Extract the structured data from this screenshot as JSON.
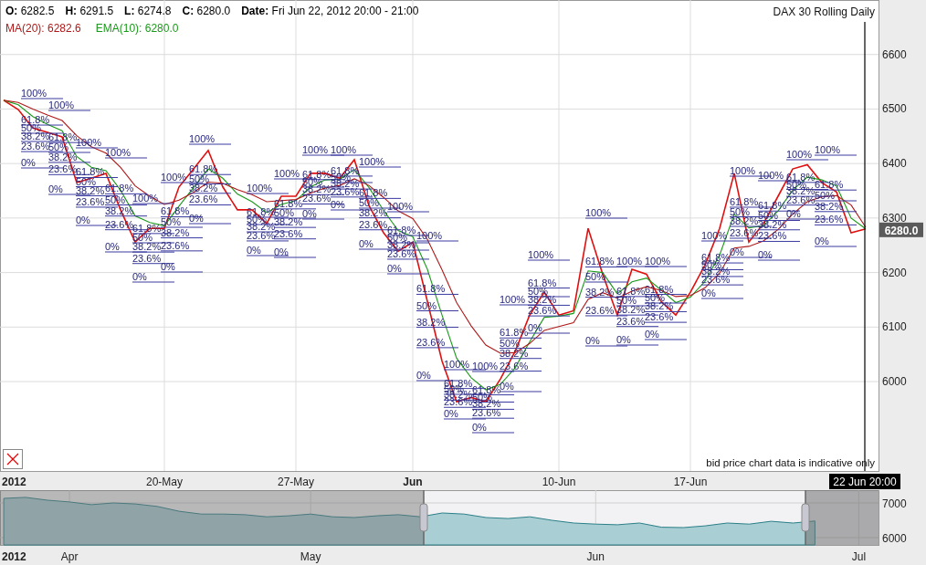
{
  "header": {
    "ohlc": [
      "**O:** 6282.5",
      "**H:** 6291.5",
      "**L:** 6274.8",
      "**C:** 6280.0",
      "**Date:** Fri Jun 22, 2012 20:00 - 21:00"
    ],
    "indicators": [
      {
        "text": "MA(20): 6282.6",
        "color": "#b01818"
      },
      {
        "text": "EMA(10): 6280.0",
        "color": "#1a9a1a"
      }
    ],
    "instrument": "DAX 30  Rolling Daily"
  },
  "main_chart": {
    "year_label": "2012",
    "price_tag": "6280.0",
    "cursor_date": "22 Jun 20:00",
    "disclaimer": "bid price chart data is indicative only",
    "chart_data": {
      "type": "line",
      "grid": true,
      "categories": [
        null,
        null,
        null,
        null,
        null,
        null,
        null,
        null,
        null,
        null,
        null,
        "20-May",
        null,
        null,
        null,
        null,
        null,
        null,
        null,
        null,
        "27-May",
        null,
        null,
        null,
        null,
        null,
        null,
        null,
        "Jun",
        null,
        null,
        null,
        null,
        null,
        null,
        null,
        null,
        null,
        "10-Jun",
        null,
        null,
        null,
        null,
        null,
        null,
        null,
        null,
        "17-Jun",
        null,
        null,
        null,
        null,
        null,
        null,
        null,
        null,
        null,
        null,
        null,
        null
      ],
      "ylim": [
        5836,
        6700
      ],
      "yticks": [
        6000,
        6100,
        6200,
        6300,
        6400,
        6500,
        6600
      ],
      "series": [
        {
          "color": "#e01010",
          "values": [
            6516,
            6499,
            6465,
            6457,
            6449,
            6365,
            6373,
            6382,
            6315,
            6256,
            6281,
            6281,
            6357,
            6390,
            6424,
            6357,
            6315,
            6315,
            6290,
            6340,
            6340,
            6382,
            6382,
            6373,
            6407,
            6323,
            6273,
            6239,
            6256,
            6147,
            6038,
            5963,
            5971,
            5963,
            6005,
            6055,
            6122,
            6164,
            6122,
            6130,
            6281,
            6197,
            6122,
            6206,
            6197,
            6147,
            6122,
            6164,
            6214,
            6281,
            6382,
            6256,
            6290,
            6340,
            6390,
            6398,
            6365,
            6348,
            6273,
            6280
          ]
        },
        {
          "color": "#1a9a1a",
          "values": [
            6516,
            6508,
            6486,
            6472,
            6460,
            6413,
            6393,
            6387,
            6351,
            6304,
            6292,
            6286,
            6322,
            6356,
            6390,
            6373,
            6344,
            6330,
            6310,
            6325,
            6332,
            6357,
            6370,
            6371,
            6389,
            6356,
            6314,
            6277,
            6266,
            6206,
            6122,
            6043,
            6007,
            5985,
            5995,
            6025,
            6073,
            6118,
            6120,
            6125,
            6203,
            6200,
            6161,
            6183,
            6190,
            6168,
            6145,
            6155,
            6184,
            6232,
            6307,
            6282,
            6286,
            6313,
            6351,
            6375,
            6370,
            6359,
            6300,
            6280
          ]
        },
        {
          "color": "#b01818",
          "values": [
            6516,
            6512,
            6500,
            6489,
            6479,
            6451,
            6431,
            6419,
            6393,
            6359,
            6340,
            6325,
            6333,
            6347,
            6366,
            6364,
            6352,
            6343,
            6330,
            6332,
            6334,
            6346,
            6355,
            6360,
            6372,
            6360,
            6338,
            6313,
            6299,
            6261,
            6205,
            6145,
            6102,
            6067,
            6052,
            6053,
            6070,
            6094,
            6101,
            6108,
            6151,
            6163,
            6153,
            6166,
            6174,
            6167,
            6156,
            6158,
            6172,
            6199,
            6245,
            6248,
            6258,
            6279,
            6307,
            6330,
            6339,
            6341,
            6324,
            6283
          ]
        }
      ],
      "annotations": [
        "100%",
        "61.8%",
        "50%",
        "38.2%",
        "23.6%",
        "0%",
        "100%",
        "61.8%",
        "50%",
        "38.2%",
        "23.6%",
        "0%",
        "100%",
        "61.8%",
        "50%",
        "38.2%",
        "23.6%",
        "0%",
        "100%",
        "61.8%",
        "50%",
        "38.2%",
        "23.6%",
        "0%",
        "100%",
        "61.8%",
        "50%",
        "38.2%",
        "23.6%",
        "0%",
        "100%",
        "61.8%",
        "50%",
        "38.2%",
        "23.6%",
        "0%",
        "100%",
        "61.8%",
        "50%",
        "38.2%",
        "23.6%",
        "0%",
        "100%",
        "61.8%",
        "50%",
        "38.2%",
        "23.6%",
        "0%",
        "100%",
        "61.8%",
        "50%",
        "38.2%",
        "23.6%",
        "0%",
        "100%",
        "61.8%",
        "50%",
        "38.2%",
        "23.6%",
        "0%",
        "100%",
        "61.8%",
        "50%",
        "38.2%",
        "23.6%",
        "0%",
        "100%",
        "61.8%",
        "50%",
        "38.2%",
        "23.6%",
        "0%",
        "100%",
        "61.8%",
        "50%",
        "38.2%",
        "23.6%",
        "0%",
        "100%",
        "61.8%",
        "50%",
        "38.2%",
        "23.6%",
        "0%",
        "100%",
        "61.8%",
        "50%",
        "38.2%",
        "23.6%",
        "0%",
        "100%",
        "61.8%",
        "50%",
        "38.2%",
        "23.6%",
        "0%",
        "100%",
        "61.8%",
        "50%",
        "38.2%",
        "23.6%",
        "0%",
        "100%",
        "61.8%",
        "50%",
        "38.2%",
        "23.6%",
        "0%",
        "100%",
        "61.8%",
        "50%",
        "38.2%",
        "23.6%",
        "0%",
        "100%",
        "61.8%",
        "50%",
        "38.2%",
        "23.6%",
        "0%",
        "100%",
        "61.8%",
        "50%",
        "38.2%",
        "23.6%",
        "0%",
        "100%",
        "61.8%",
        "50%",
        "38.2%",
        "23.6%",
        "0%",
        "100%",
        "61.8%",
        "50%",
        "38.2%",
        "23.6%",
        "0%",
        "100%",
        "61.8%",
        "50%",
        "38.2%",
        "23.6%",
        "0%",
        "100%",
        "61.8%",
        "50%",
        "38.2%",
        "23.6%",
        "0%",
        "100%",
        "61.8%",
        "50%",
        "38.2%",
        "23.6%",
        "0%"
      ]
    }
  },
  "navigator": {
    "year_label": "2012",
    "chart_data": {
      "type": "area",
      "grid": true,
      "categories": [
        null,
        null,
        null,
        "Apr",
        null,
        null,
        null,
        null,
        null,
        null,
        null,
        null,
        null,
        null,
        "May",
        null,
        null,
        null,
        null,
        null,
        null,
        null,
        null,
        null,
        null,
        null,
        null,
        "Jun",
        null,
        null,
        null,
        null,
        null,
        null,
        null,
        null,
        null,
        null,
        null,
        "Jul"
      ],
      "ylim": [
        5790,
        7368
      ],
      "yticks": [
        6000,
        7000
      ],
      "series": [
        {
          "color": "#2a8088",
          "values": [
            7130,
            7160,
            7080,
            7030,
            6950,
            7000,
            6970,
            6900,
            6760,
            6680,
            6680,
            6660,
            6600,
            6630,
            6680,
            6600,
            6580,
            6630,
            6660,
            6600,
            6710,
            6680,
            6580,
            6550,
            6600,
            6500,
            6420,
            6390,
            6370,
            6420,
            6300,
            6290,
            6340,
            6420,
            6390,
            6470,
            6420,
            6480,
            null,
            null
          ]
        }
      ]
    }
  }
}
